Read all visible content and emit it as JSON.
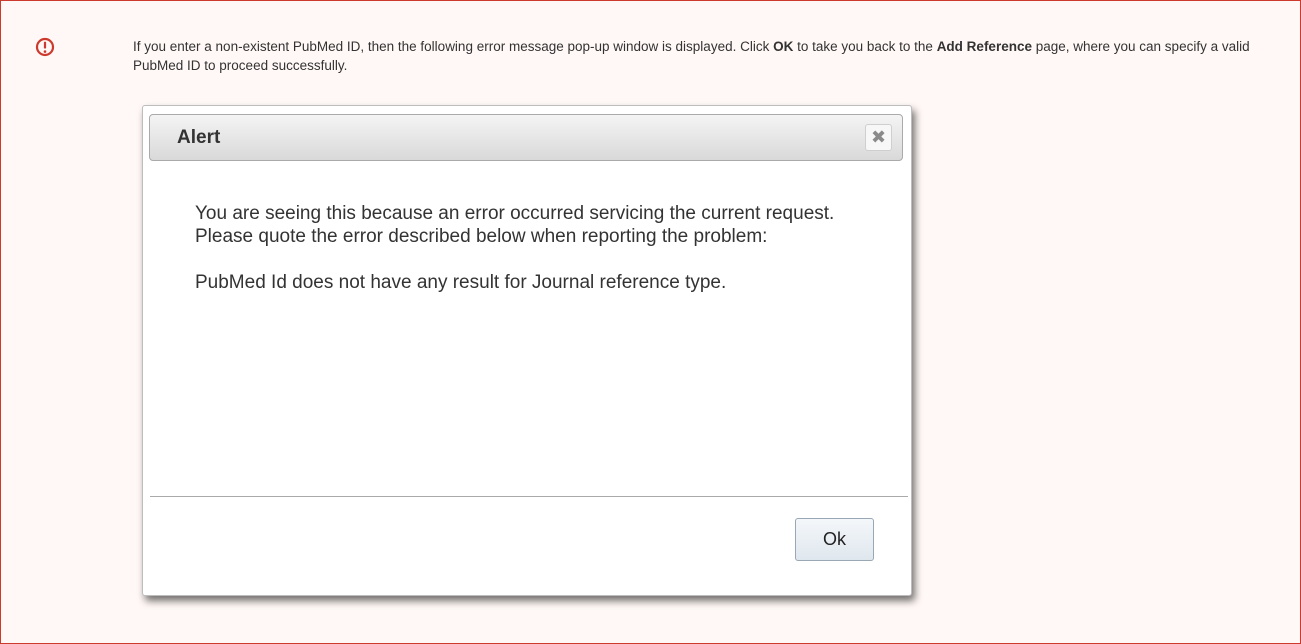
{
  "note": {
    "icon": "warning-circle-icon",
    "accent_color": "#cc3a2e",
    "text_part1": "If you enter a non-existent PubMed ID, then the following error message pop-up window is displayed. Click ",
    "bold_ok": "OK",
    "text_part2": " to take you back to the ",
    "bold_add_reference": "Add Reference",
    "text_part3": " page, where you can specify a valid PubMed ID to proceed successfully."
  },
  "dialog": {
    "title": "Alert",
    "close_icon": "close-icon",
    "message_line1": "You are seeing this because an error occurred servicing the current request.",
    "message_line2": "Please quote the error described below when reporting the problem:",
    "message_line3": "PubMed Id does not have any result for Journal reference type.",
    "ok_label": "Ok"
  }
}
